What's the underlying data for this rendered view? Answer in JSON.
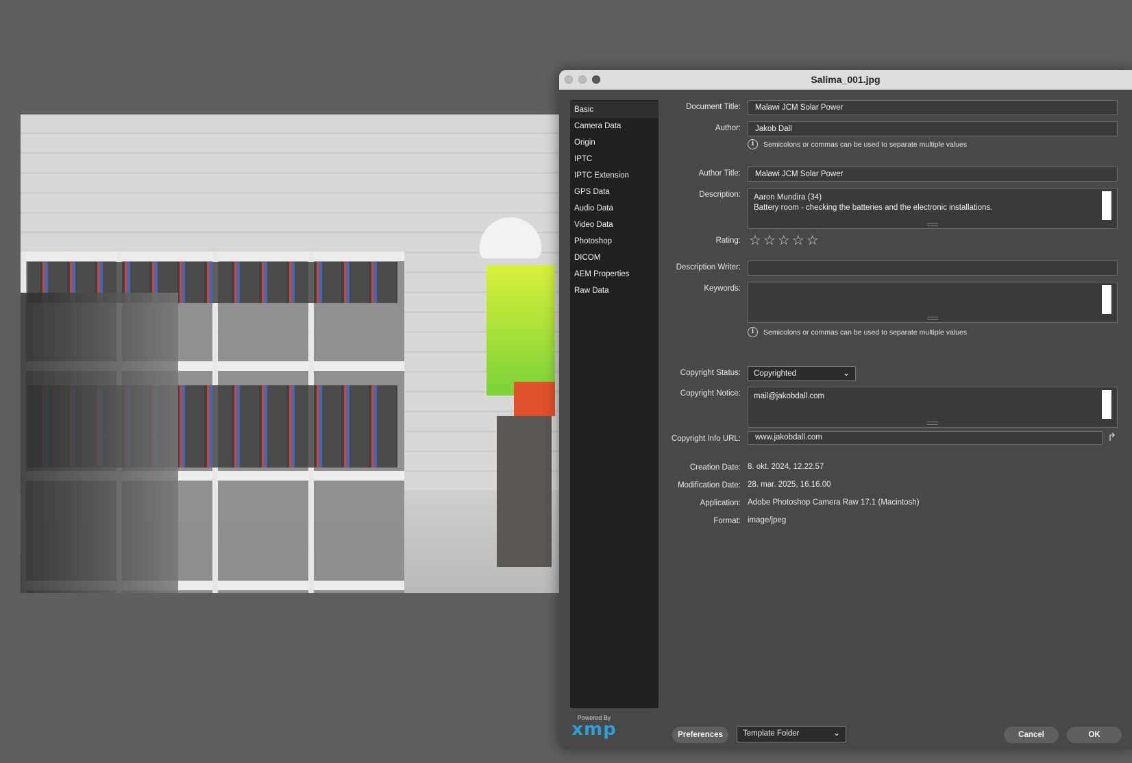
{
  "window": {
    "title": "Salima_001.jpg"
  },
  "sidebar": {
    "items": [
      {
        "label": "Basic"
      },
      {
        "label": "Camera Data"
      },
      {
        "label": "Origin"
      },
      {
        "label": "IPTC"
      },
      {
        "label": "IPTC Extension"
      },
      {
        "label": "GPS Data"
      },
      {
        "label": "Audio Data"
      },
      {
        "label": "Video Data"
      },
      {
        "label": "Photoshop"
      },
      {
        "label": "DICOM"
      },
      {
        "label": "AEM Properties"
      },
      {
        "label": "Raw Data"
      }
    ]
  },
  "labels": {
    "document_title": "Document Title:",
    "author": "Author:",
    "author_title": "Author Title:",
    "description": "Description:",
    "rating": "Rating:",
    "description_writer": "Description Writer:",
    "keywords": "Keywords:",
    "copyright_status": "Copyright Status:",
    "copyright_notice": "Copyright Notice:",
    "copyright_info_url": "Copyright Info URL:",
    "creation_date": "Creation Date:",
    "modification_date": "Modification Date:",
    "application": "Application:",
    "format": "Format:"
  },
  "values": {
    "document_title": "Malawi JCM Solar Power",
    "author": "Jakob Dall",
    "author_title": "Malawi JCM Solar Power",
    "description_line1": "Aaron Mundira (34)",
    "description_line2": "Battery room - checking the batteries and the electronic installations.",
    "rating_stars": "☆☆☆☆☆",
    "rating": 0,
    "description_writer": "",
    "keywords": "",
    "copyright_status": "Copyrighted",
    "copyright_notice": "mail@jakobdall.com",
    "copyright_info_url": "www.jakobdall.com",
    "creation_date": "8. okt. 2024, 12.22.57",
    "modification_date": "28. mar. 2025, 16.16.00",
    "application": "Adobe Photoshop Camera Raw 17.1 (Macintosh)",
    "format": "image/jpeg"
  },
  "hints": {
    "separator": "Semicolons or commas can be used to separate multiple values"
  },
  "footer": {
    "powered_by": "Powered By",
    "xmp_logo": "xmp",
    "preferences": "Preferences",
    "template_folder": "Template Folder",
    "cancel": "Cancel",
    "ok": "OK"
  },
  "colors": {
    "background": "#5f5f5f",
    "dialog": "#484848",
    "sidebar": "#202020",
    "xmp_blue": "#2f9fd8"
  }
}
